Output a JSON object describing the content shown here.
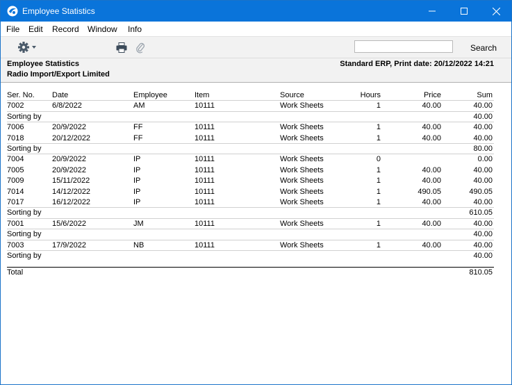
{
  "window": {
    "title": "Employee Statistics"
  },
  "menu": [
    "File",
    "Edit",
    "Record",
    "Window",
    "Info"
  ],
  "toolbar": {
    "search_value": "",
    "search_label": "Search"
  },
  "report_header": {
    "title": "Employee Statistics",
    "company": "Radio Import/Export Limited",
    "right": "Standard ERP, Print date: 20/12/2022 14:21"
  },
  "columns": [
    "Ser. No.",
    "Date",
    "Employee",
    "Item",
    "Source",
    "Hours",
    "Price",
    "Sum"
  ],
  "groups": [
    {
      "rows": [
        {
          "ser": "7002",
          "date": "6/8/2022",
          "emp": "AM",
          "item": "10111",
          "src": "Work Sheets",
          "hours": "1",
          "price": "40.00",
          "sum": "40.00"
        }
      ],
      "sorting_label": "Sorting by",
      "sorting_sum": "40.00"
    },
    {
      "rows": [
        {
          "ser": "7006",
          "date": "20/9/2022",
          "emp": "FF",
          "item": "10111",
          "src": "Work Sheets",
          "hours": "1",
          "price": "40.00",
          "sum": "40.00"
        },
        {
          "ser": "7018",
          "date": "20/12/2022",
          "emp": "FF",
          "item": "10111",
          "src": "Work Sheets",
          "hours": "1",
          "price": "40.00",
          "sum": "40.00"
        }
      ],
      "sorting_label": "Sorting by",
      "sorting_sum": "80.00"
    },
    {
      "rows": [
        {
          "ser": "7004",
          "date": "20/9/2022",
          "emp": "IP",
          "item": "10111",
          "src": "Work Sheets",
          "hours": "0",
          "price": "",
          "sum": "0.00"
        },
        {
          "ser": "7005",
          "date": "20/9/2022",
          "emp": "IP",
          "item": "10111",
          "src": "Work Sheets",
          "hours": "1",
          "price": "40.00",
          "sum": "40.00"
        },
        {
          "ser": "7009",
          "date": "15/11/2022",
          "emp": "IP",
          "item": "10111",
          "src": "Work Sheets",
          "hours": "1",
          "price": "40.00",
          "sum": "40.00"
        },
        {
          "ser": "7014",
          "date": "14/12/2022",
          "emp": "IP",
          "item": "10111",
          "src": "Work Sheets",
          "hours": "1",
          "price": "490.05",
          "sum": "490.05"
        },
        {
          "ser": "7017",
          "date": "16/12/2022",
          "emp": "IP",
          "item": "10111",
          "src": "Work Sheets",
          "hours": "1",
          "price": "40.00",
          "sum": "40.00"
        }
      ],
      "sorting_label": "Sorting by",
      "sorting_sum": "610.05"
    },
    {
      "rows": [
        {
          "ser": "7001",
          "date": "15/6/2022",
          "emp": "JM",
          "item": "10111",
          "src": "Work Sheets",
          "hours": "1",
          "price": "40.00",
          "sum": "40.00"
        }
      ],
      "sorting_label": "Sorting by",
      "sorting_sum": "40.00"
    },
    {
      "rows": [
        {
          "ser": "7003",
          "date": "17/9/2022",
          "emp": "NB",
          "item": "10111",
          "src": "Work Sheets",
          "hours": "1",
          "price": "40.00",
          "sum": "40.00"
        }
      ],
      "sorting_label": "Sorting by",
      "sorting_sum": "40.00"
    }
  ],
  "total": {
    "label": "Total",
    "sum": "810.05"
  },
  "icons": {
    "app": "app-logo-icon",
    "minimize": "minimize-icon",
    "maximize": "maximize-icon",
    "close": "close-icon",
    "gear": "gear-icon",
    "print": "print-icon",
    "attach": "paperclip-icon"
  },
  "colors": {
    "titlebar": "#0a74da",
    "toolbar": "#f2f2f2"
  }
}
